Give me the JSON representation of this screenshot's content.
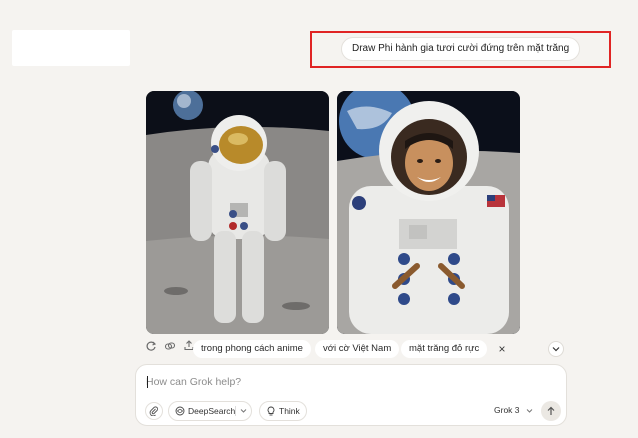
{
  "user_prompt": "Draw Phi hành gia tươi cười đứng trên mặt trăng",
  "images": [
    {
      "name": "astronaut-image-1",
      "icon": "astronaut-photo"
    },
    {
      "name": "astronaut-image-2",
      "icon": "astronaut-photo"
    }
  ],
  "image_actions": [
    "refresh-icon",
    "link-icon",
    "share-icon"
  ],
  "suggestions": {
    "items": [
      "trong phong cách anime",
      "với cờ Việt Nam",
      "mặt trăng đỏ rực"
    ],
    "close_symbol": "×"
  },
  "composer": {
    "placeholder": "How can Grok help?",
    "deepsearch_label": "DeepSearch",
    "think_label": "Think",
    "model_label": "Grok 3"
  },
  "colors": {
    "background": "#f5f3f0",
    "highlight": "#e02424"
  }
}
